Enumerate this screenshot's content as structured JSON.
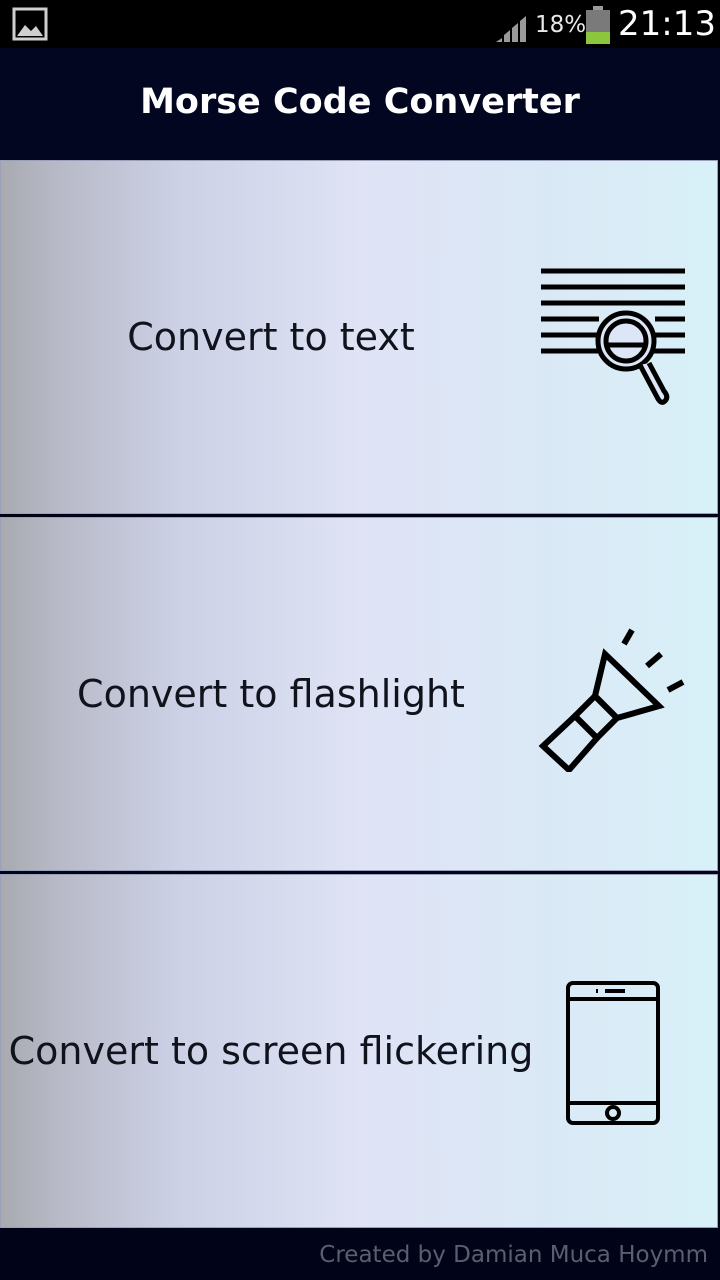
{
  "status_bar": {
    "battery_percent": "18%",
    "time": "21:13",
    "icons": [
      "gallery-icon",
      "signal-icon",
      "battery-icon"
    ],
    "battery_level": 0.18,
    "battery_color": "#8cc63f"
  },
  "header": {
    "title": "Morse Code Converter"
  },
  "options": [
    {
      "label": "Convert to text",
      "icon": "text-search-icon"
    },
    {
      "label": "Convert to flashlight",
      "icon": "flashlight-icon"
    },
    {
      "label": "Convert to screen flickering",
      "icon": "smartphone-icon"
    }
  ],
  "footer": {
    "credit": "Created by Damian Muca Hoymm"
  },
  "colors": {
    "header_background": "#020620",
    "label_text": "#10121c",
    "footer_text": "#5a5e6e"
  }
}
